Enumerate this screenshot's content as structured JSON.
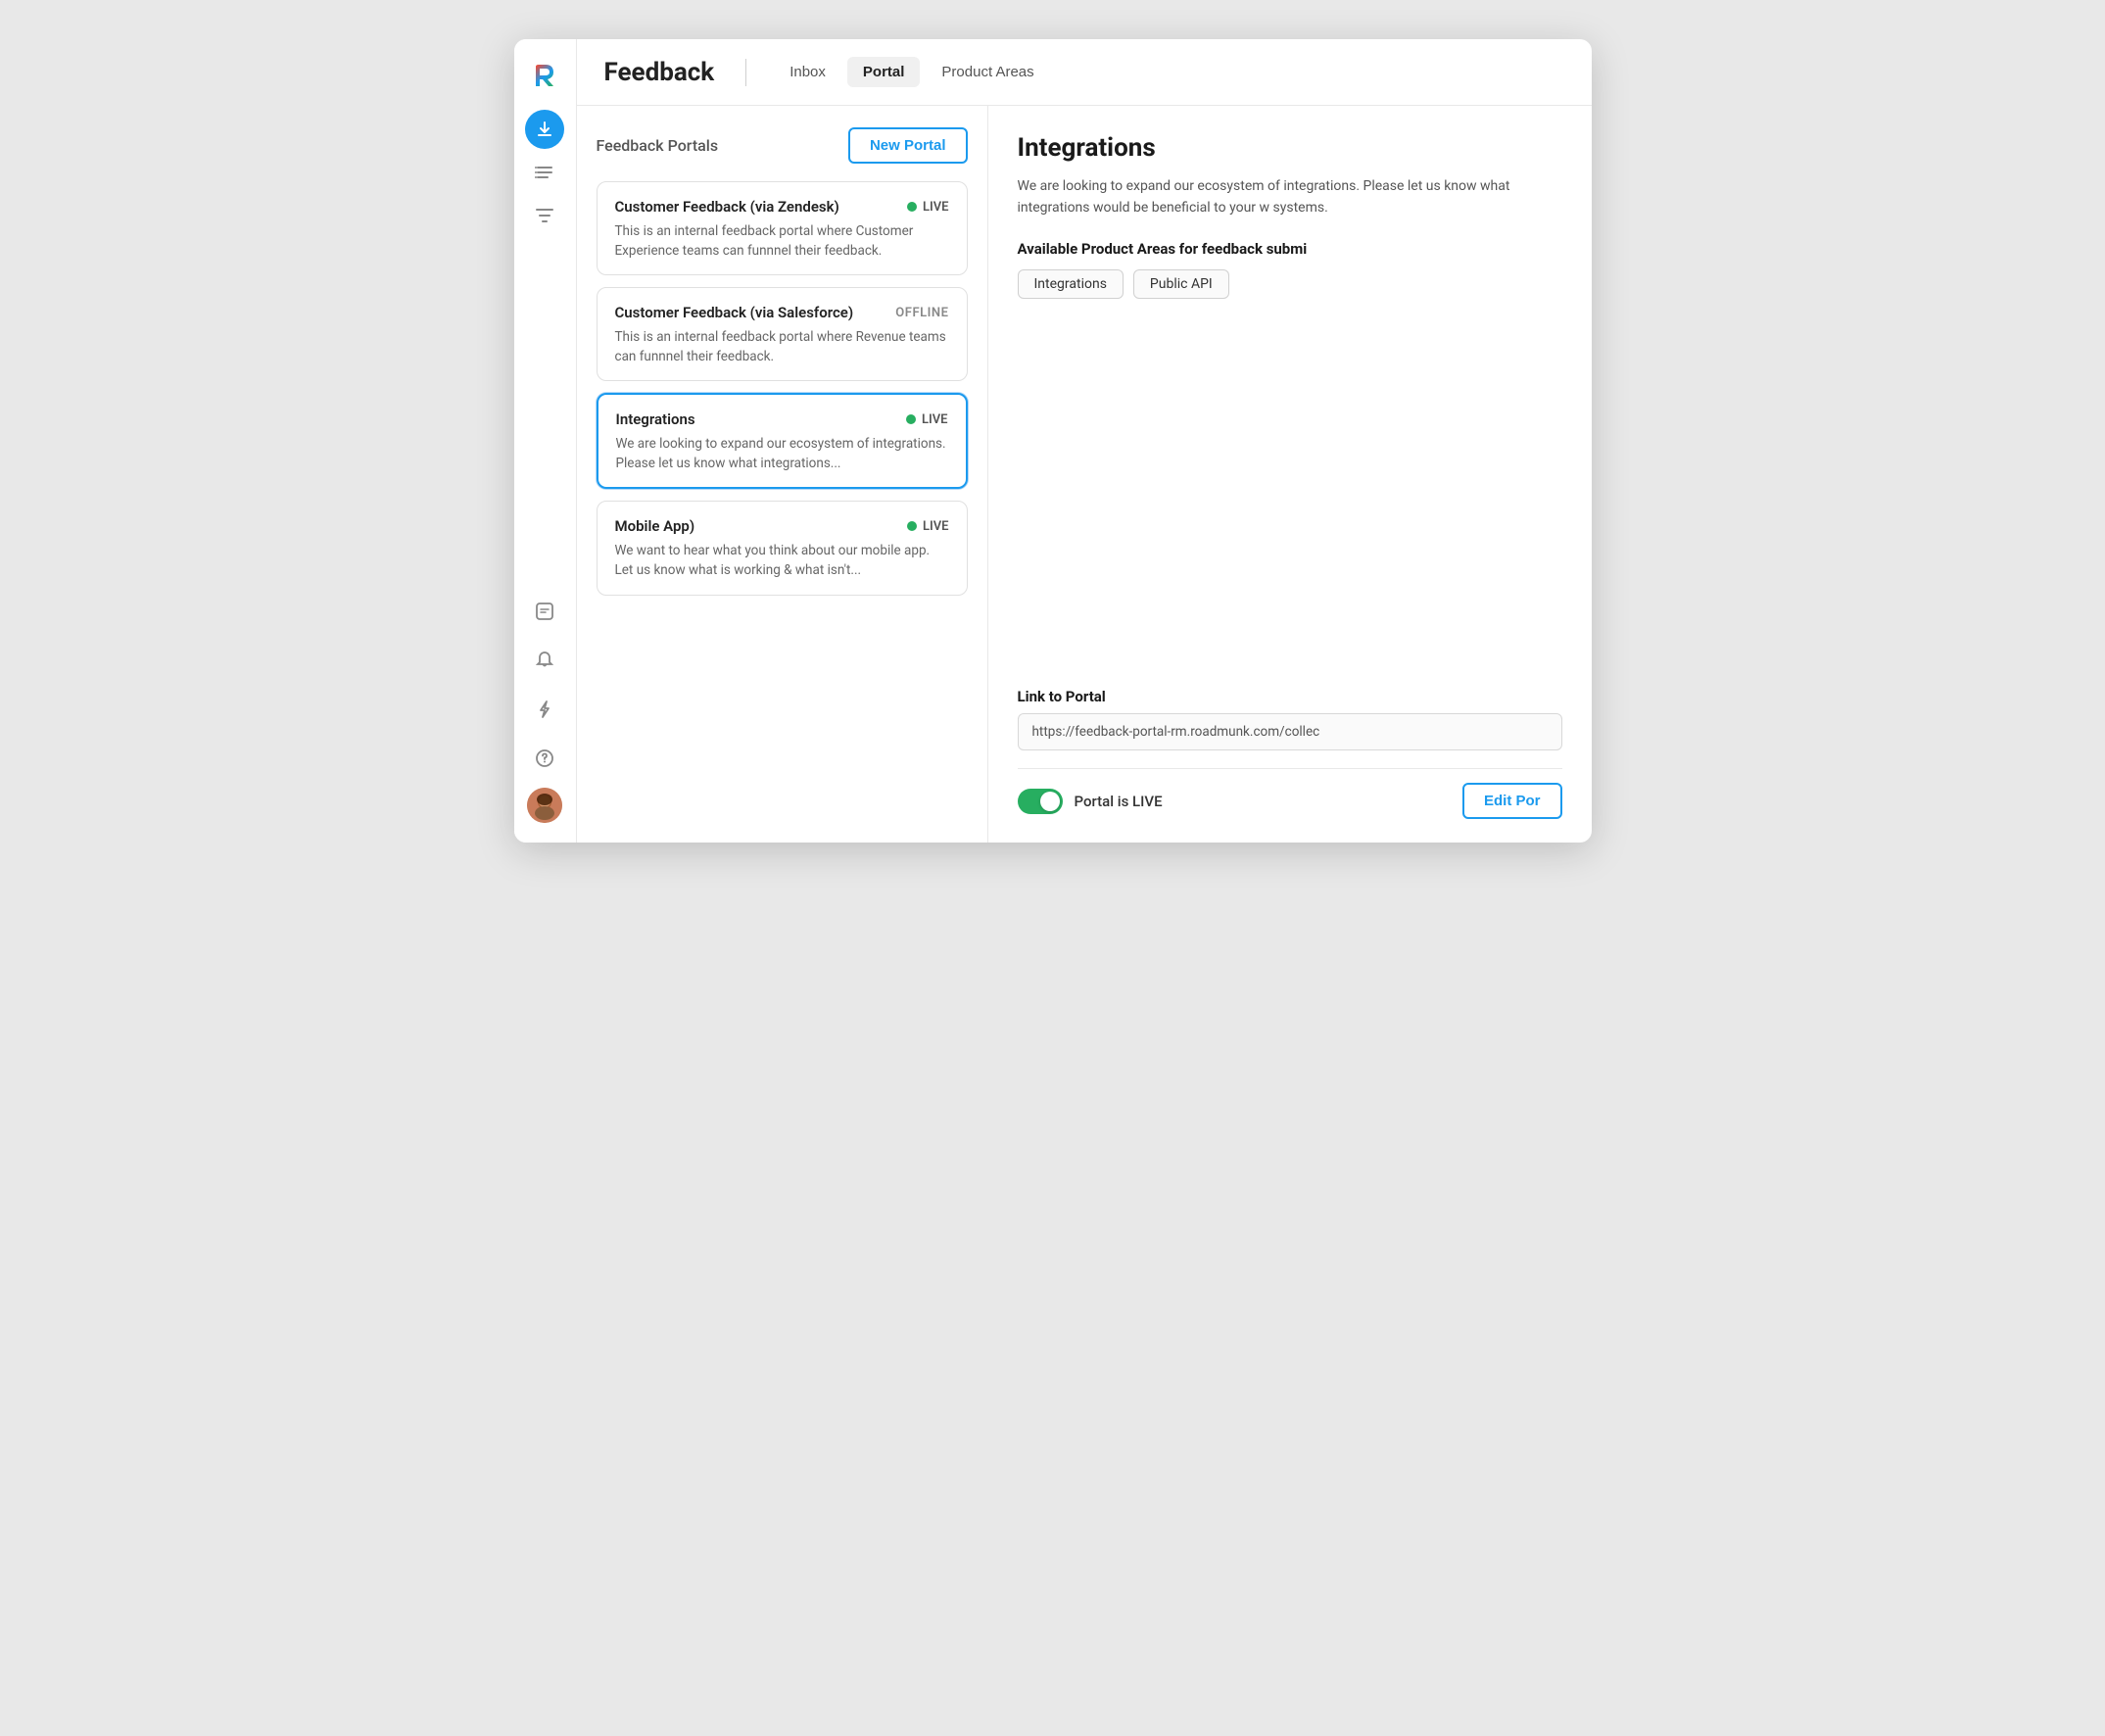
{
  "app": {
    "title": "Feedback"
  },
  "topbar": {
    "title": "Feedback",
    "tabs": [
      {
        "id": "inbox",
        "label": "Inbox",
        "active": false
      },
      {
        "id": "portal",
        "label": "Portal",
        "active": true
      },
      {
        "id": "product-areas",
        "label": "Product Areas",
        "active": false
      }
    ]
  },
  "left_panel": {
    "title": "Feedback Portals",
    "new_portal_label": "New Portal",
    "portals": [
      {
        "id": "zendesk",
        "name": "Customer Feedback (via Zendesk)",
        "description": "This is an internal feedback portal where Customer Experience teams can funnnel their feedback.",
        "status": "LIVE",
        "selected": false
      },
      {
        "id": "salesforce",
        "name": "Customer Feedback (via Salesforce)",
        "description": "This is an internal feedback portal where Revenue teams can funnnel their feedback.",
        "status": "OFFLINE",
        "selected": false
      },
      {
        "id": "integrations",
        "name": "Integrations",
        "description": "We are looking to expand our ecosystem of integrations. Please let us know what integrations...",
        "status": "LIVE",
        "selected": true
      },
      {
        "id": "mobile",
        "name": "Mobile App)",
        "description": "We want to hear what you think about our mobile app. Let us know what is working & what isn't...",
        "status": "LIVE",
        "selected": false
      }
    ]
  },
  "right_panel": {
    "title": "Integrations",
    "description": "We are looking to expand our ecosystem of integrations. Please let us know what integrations would be beneficial to your w systems.",
    "product_areas_label": "Available Product Areas for feedback submi",
    "tags": [
      {
        "label": "Integrations"
      },
      {
        "label": "Public API"
      }
    ],
    "link_label": "Link to Portal",
    "link_value": "https://feedback-portal-rm.roadmunk.com/collec",
    "toggle_label": "Portal is LIVE",
    "edit_portal_label": "Edit Por"
  },
  "sidebar": {
    "icons": [
      {
        "name": "download-icon",
        "symbol": "⬇",
        "active": true
      },
      {
        "name": "list-icon",
        "symbol": "≡",
        "active": false
      },
      {
        "name": "filter-icon",
        "symbol": "≔",
        "active": false
      }
    ],
    "bottom_icons": [
      {
        "name": "contact-icon",
        "symbol": "👤"
      },
      {
        "name": "bell-icon",
        "symbol": "🔔"
      },
      {
        "name": "bolt-icon",
        "symbol": "⚡"
      },
      {
        "name": "help-icon",
        "symbol": "?"
      }
    ]
  },
  "colors": {
    "accent": "#1b9aee",
    "live": "#27ae60",
    "offline": "#888888"
  }
}
